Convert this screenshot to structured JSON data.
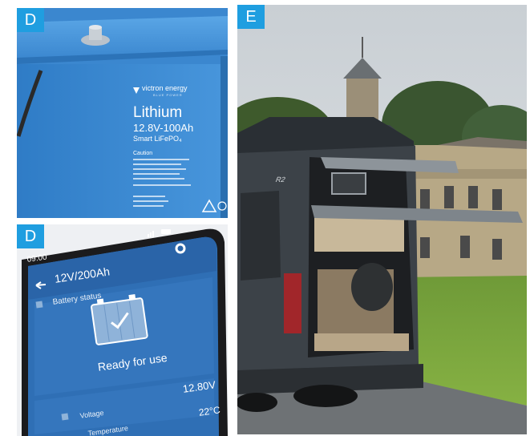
{
  "panels": {
    "battery": {
      "label": "D",
      "brand": "victron energy",
      "brand_tagline": "BLUE POWER",
      "product": "Lithium",
      "spec": "12.8V-100Ah",
      "subtitle": "Smart LiFePO₄",
      "caution_title": "Caution"
    },
    "phone": {
      "label": "D",
      "status_time": "09:00",
      "app_title": "12V/200Ah",
      "battery_status_label": "Battery status",
      "ready_text": "Ready for use",
      "voltage_value": "12.80V",
      "voltage_label": "Voltage",
      "temperature_value": "22°C",
      "temperature_label": "Temperature"
    },
    "van": {
      "label": "E",
      "rear_badge": "R2"
    }
  },
  "colors": {
    "badge": "#1f9ee0",
    "battery_blue": "#3f8ed6",
    "app_blue": "#2f6fb5"
  }
}
